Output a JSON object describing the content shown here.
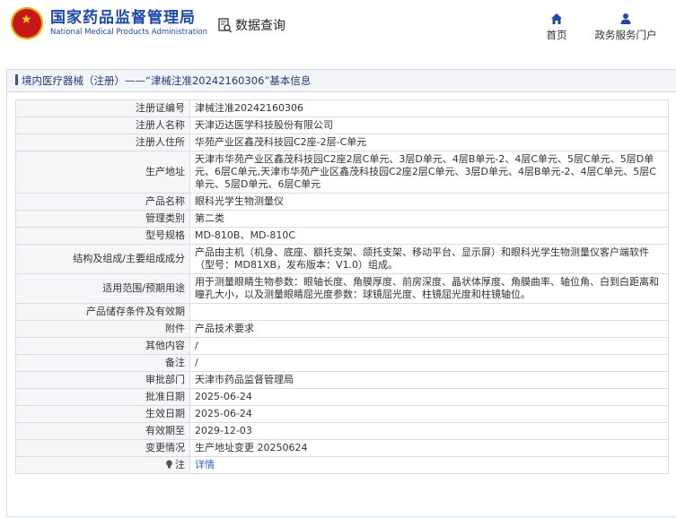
{
  "header": {
    "logo_cn": "国家药品监督管理局",
    "logo_en": "National Medical Products Administration",
    "query_label": "数据查询",
    "nav": [
      {
        "label": "首页",
        "icon": "home-icon"
      },
      {
        "label": "政务服务门户",
        "icon": "user-icon"
      }
    ]
  },
  "panel": {
    "title": "境内医疗器械（注册）——“津械注准20242160306”基本信息"
  },
  "rows": [
    {
      "key": "注册证编号",
      "value": "津械注准20242160306"
    },
    {
      "key": "注册人名称",
      "value": "天津迈达医学科技股份有限公司"
    },
    {
      "key": "注册人住所",
      "value": "华苑产业区鑫茂科技园C2座-2层-C单元"
    },
    {
      "key": "生产地址",
      "value": "天津市华苑产业区鑫茂科技园C2座2层C单元、3层D单元、4层B单元-2、4层C单元、5层C单元、5层D单元、6层C单元,天津市华苑产业区鑫茂科技园C2座2层C单元、3层D单元、4层B单元-2、4层C单元、5层C单元、5层D单元、6层C单元"
    },
    {
      "key": "产品名称",
      "value": "眼科光学生物测量仪"
    },
    {
      "key": "管理类别",
      "value": "第二类"
    },
    {
      "key": "型号规格",
      "value": "MD-810B、MD-810C"
    },
    {
      "key": "结构及组成/主要组成成分",
      "value": "产品由主机（机身、底座、额托支架、颌托支架、移动平台、显示屏）和眼科光学生物测量仪客户端软件（型号：MD81XB，发布版本：V1.0）组成。"
    },
    {
      "key": "适用范围/预期用途",
      "value": "用于测量眼睛生物参数：眼轴长度、角膜厚度、前房深度、晶状体厚度、角膜曲率、轴位角、白到白距离和瞳孔大小，以及测量眼睛屈光度参数：球镜屈光度、柱镜屈光度和柱镜轴位。"
    },
    {
      "key": "产品储存条件及有效期",
      "value": ""
    },
    {
      "key": "附件",
      "value": "产品技术要求"
    },
    {
      "key": "其他内容",
      "value": "/"
    },
    {
      "key": "备注",
      "value": "/"
    },
    {
      "key": "审批部门",
      "value": "天津市药品监督管理局"
    },
    {
      "key": "批准日期",
      "value": "2025-06-24"
    },
    {
      "key": "生效日期",
      "value": "2025-06-24"
    },
    {
      "key": "有效期至",
      "value": "2029-12-03"
    },
    {
      "key": "变更情况",
      "value": "生产地址变更 20250624"
    }
  ],
  "note_row": {
    "key": "注",
    "value": "详情"
  },
  "colors": {
    "brand_blue": "#1d4aa7",
    "link_blue": "#2b5fc2",
    "emblem_red": "#c8161d"
  }
}
